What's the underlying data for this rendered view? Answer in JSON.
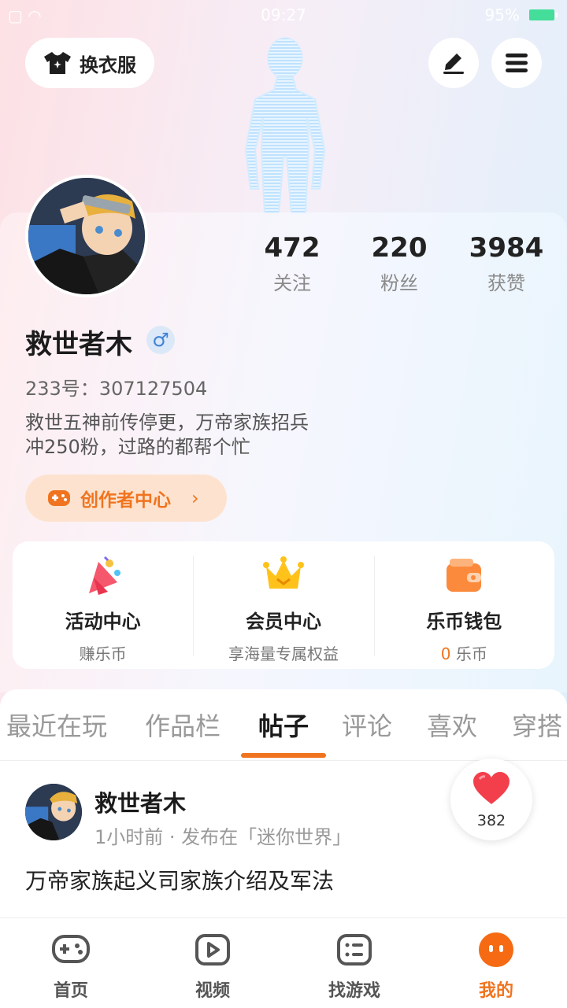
{
  "status_bar": {
    "time": "09:27",
    "battery": "95%"
  },
  "header": {
    "outfit_label": "换衣服",
    "edit_icon": "pencil-icon",
    "menu_icon": "menu-icon"
  },
  "profile": {
    "name": "救世者木",
    "gender_symbol": "♂",
    "id_text": "233号：307127504",
    "bio_line1": "救世五神前传停更，万帝家族招兵",
    "bio_line2": "冲250粉，过路的都帮个忙",
    "creator_label": "创作者中心",
    "stats": [
      {
        "num": "472",
        "label": "关注"
      },
      {
        "num": "220",
        "label": "粉丝"
      },
      {
        "num": "3984",
        "label": "获赞"
      }
    ]
  },
  "services": [
    {
      "title": "活动中心",
      "sub": "赚乐币"
    },
    {
      "title": "会员中心",
      "sub": "享海量专属权益"
    },
    {
      "title": "乐币钱包",
      "sub_value": "0",
      "sub_unit": "乐币"
    }
  ],
  "tabs": [
    "最近在玩",
    "作品栏",
    "帖子",
    "评论",
    "喜欢",
    "穿搭"
  ],
  "active_tab": "帖子",
  "post": {
    "author": "救世者木",
    "meta": "1小时前 · 发布在「迷你世界」",
    "title": "万帝家族起义司家族介绍及军法",
    "likes": "382"
  },
  "nav": [
    {
      "label": "首页",
      "icon": "gamepad-icon"
    },
    {
      "label": "视频",
      "icon": "video-play-icon"
    },
    {
      "label": "找游戏",
      "icon": "list-icon"
    },
    {
      "label": "我的",
      "icon": "profile-face-icon"
    }
  ],
  "colors": {
    "accent": "#f0741f",
    "male_blue": "#3d82d8"
  }
}
